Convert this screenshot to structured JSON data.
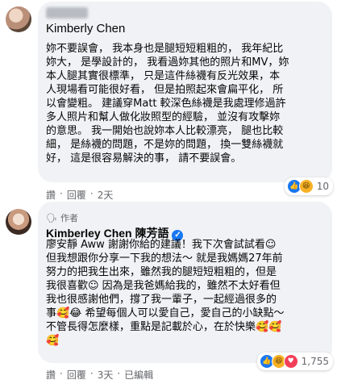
{
  "comment1": {
    "collapse_icon": "close-icon",
    "author": "Kimberly Chen",
    "lines": [
      "妳不要誤會， 我本身也是腿短短粗粗的， 我年紀比",
      "妳大，  是學設計的， 我看過妳其他的照片和MV，妳",
      "本人腿其實很標準， 只是這件絲襪有反光效果，本",
      "人現場看可能很好看， 但是拍照起來會扁平化， 所",
      "以會變粗。 建議穿Matt 較深色絲襪是我處理修過許",
      "多人照片和幫人做化妝照型的經驗， 並沒有攻擊妳",
      "的意思。 我一開始也說妳本人比較漂亮，  腿也比較",
      "細， 是絲襪的問題，不是妳的問題， 換一雙絲襪就",
      "好， 這是很容易解決的事， 請不要誤會。"
    ],
    "actions": {
      "like": "讚",
      "reply": "回覆",
      "time": "2天"
    },
    "reactions": {
      "icons": [
        "like-icon",
        "laugh-icon"
      ],
      "count": "10"
    }
  },
  "comment2": {
    "badge": "作者",
    "author": "Kimberley Chen 陳芳語",
    "lines": [
      "廖安靜 Aww 謝謝你給的建議！我下次會試試看☺",
      "但我想跟你分享一下我的想法～ 就是我媽媽27年前",
      "努力的把我生出來，雖然我的腿短短粗粗的，但是",
      "我很喜歡☺ 因為是我爸媽給我的，雖然不太好看但",
      "我也很感謝他們，撐了我一輩子，一起經過很多的",
      "事🥰😂 希望每個人可以愛自己，愛自己的小缺點～",
      "不管長得怎麼樣，重點是記載於心，在於快樂🥰🥰",
      "🥰"
    ],
    "actions": {
      "like": "讚",
      "reply": "回覆",
      "time": "3天",
      "edited": "已編輯"
    },
    "reactions": {
      "icons": [
        "like-icon",
        "laugh-icon",
        "heart-icon"
      ],
      "count": "1,755"
    }
  }
}
